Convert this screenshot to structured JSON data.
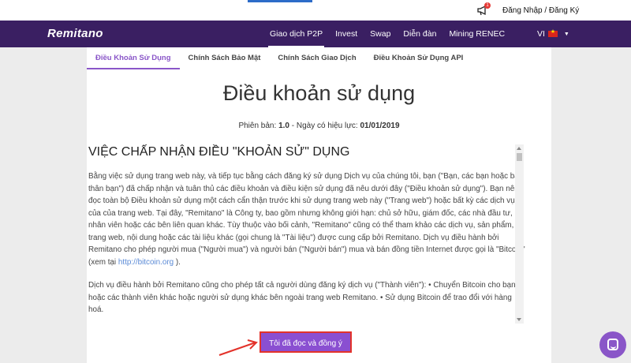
{
  "topbar": {
    "login_label": "Đăng Nhập / Đăng Ký",
    "notification_count": "1"
  },
  "nav": {
    "logo": "Remitano",
    "items": [
      "Giao dịch P2P",
      "Invest",
      "Swap",
      "Diễn đàn",
      "Mining RENEC"
    ],
    "language": "VI"
  },
  "tabs": [
    "Điều Khoản Sử Dụng",
    "Chính Sách Bảo Mật",
    "Chính Sách Giao Dịch",
    "Điều Khoản Sử Dụng API"
  ],
  "page": {
    "title": "Điều khoản sử dụng",
    "version_prefix": "Phiên bản: ",
    "version": "1.0",
    "effective_prefix": " - Ngày có hiệu lực: ",
    "effective_date": "01/01/2019"
  },
  "content": {
    "heading": "VIỆC CHẤP NHẬN ĐIỀU \"KHOẢN SỬ\" DỤNG",
    "para1": "Bằng việc sử dụng trang web này, và tiếp tục bằng cách đăng ký sử dụng Dịch vụ của chúng tôi, bạn (\"Bạn, các bạn hoặc bản thân bạn\") đã chấp nhận và tuân thủ các điều khoản và điều kiện sử dụng đã nêu dưới đây (\"Điều khoản sử dụng\"). Bạn nên đọc toàn bộ Điều khoản sử dụng một cách cẩn thận trước khi sử dụng trang web này (\"Trang web\") hoặc bất kỳ các dịch vụ của của trang web. Tại đây, \"Remitano\" là Công ty, bao gồm nhưng không giới hạn: chủ sở hữu, giám đốc, các nhà đầu tư, nhân viên hoặc các bên liên quan khác. Tùy thuộc vào bối cảnh, \"Remitano\" cũng có thể tham khảo các dịch vụ, sản phẩm, trang web, nội dung hoặc các tài liệu khác (gọi chung là \"Tài liệu\") được cung cấp bởi Remitano. Dịch vụ điều hành bởi Remitano cho phép người mua (\"Người mua\") và người bán (\"Người bán\") mua và bán đồng tiền Internet được gọi là \"Bitcoin\" (xem tại ",
    "link": "http://bitcoin.org",
    "para1_end": " ).",
    "para2": "Dịch vụ điều hành bởi Remitano cũng cho phép tất cả người dùng đăng ký dịch vụ (\"Thành viên\"): • Chuyển Bitcoin cho bạn hoặc các thành viên khác hoặc người sử dụng khác bên ngoài trang web Remitano. • Sử dụng Bitcoin để trao đổi với hàng hoá."
  },
  "agree_button": "Tôi đã đọc và đồng ý",
  "colors": {
    "nav_bg": "#3a1f62",
    "accent": "#8a56c8",
    "highlight_border": "#e3322a"
  }
}
